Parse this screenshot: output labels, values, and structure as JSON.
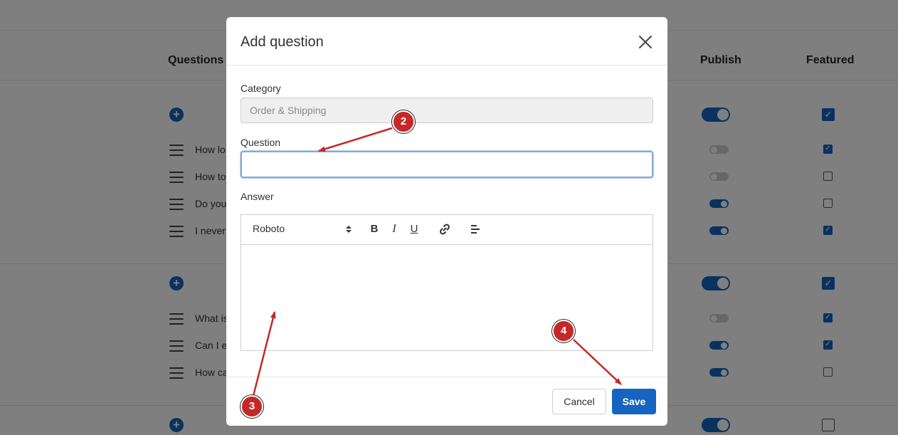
{
  "table": {
    "header_questions": "Questions",
    "header_publish": "Publish",
    "header_featured": "Featured",
    "rows": [
      {
        "text": "How lo",
        "publish": false,
        "featured": true
      },
      {
        "text": "How to",
        "publish": false,
        "featured": false
      },
      {
        "text": "Do you",
        "publish": true,
        "featured": false
      },
      {
        "text": "I never",
        "publish": true,
        "featured": true
      },
      {
        "text": "What is",
        "publish": false,
        "featured": true
      },
      {
        "text": "Can I ex",
        "publish": true,
        "featured": true
      },
      {
        "text": "How ca",
        "publish": true,
        "featured": false
      }
    ],
    "categories": [
      {
        "publish": true,
        "featured": true
      },
      {
        "publish": true,
        "featured": true
      },
      {
        "publish": true,
        "featured": false
      }
    ]
  },
  "modal": {
    "title": "Add question",
    "category_label": "Category",
    "category_value": "Order & Shipping",
    "question_label": "Question",
    "question_value": "",
    "answer_label": "Answer",
    "font_name": "Roboto",
    "cancel_label": "Cancel",
    "save_label": "Save"
  },
  "annotations": {
    "step2": "2",
    "step3": "3",
    "step4": "4"
  },
  "colors": {
    "accent": "#1565c0",
    "marker": "#c62828"
  },
  "icons": [
    "add-icon",
    "drag-handle-icon",
    "close-icon",
    "bold-icon",
    "italic-icon",
    "underline-icon",
    "link-icon",
    "align-left-icon",
    "select-arrows-icon"
  ]
}
